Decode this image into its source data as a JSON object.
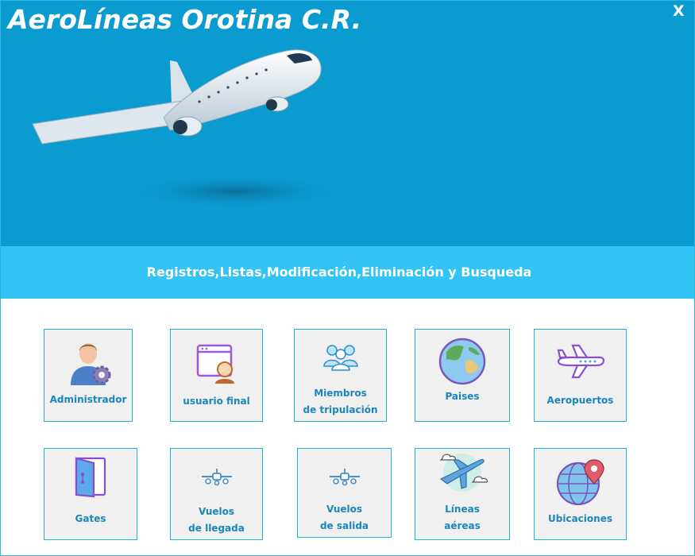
{
  "window": {
    "title": "AeroLíneas Orotina C.R.",
    "close_label": "X"
  },
  "subtitle": "Registros,Listas,Modificación,Eliminación y Busqueda",
  "colors": {
    "hero_background": "#0a9bd0",
    "band_background": "#33c4f5",
    "tile_border": "#24b1d6",
    "tile_background": "#f0f0f0",
    "tile_label": "#1b86bb"
  },
  "tiles": [
    {
      "label_line1": "Administrador",
      "label_line2": "",
      "icon": "admin-user-gear-icon"
    },
    {
      "label_line1": "usuario final",
      "label_line2": "",
      "icon": "end-user-browser-icon"
    },
    {
      "label_line1": "Miembros",
      "label_line2": "de tripulación",
      "icon": "crew-group-icon"
    },
    {
      "label_line1": "Paises",
      "label_line2": "",
      "icon": "globe-icon"
    },
    {
      "label_line1": "Aeropuertos",
      "label_line2": "",
      "icon": "airplane-icon"
    },
    {
      "label_line1": "Gates",
      "label_line2": "",
      "icon": "gate-door-icon"
    },
    {
      "label_line1": "Vuelos",
      "label_line2": "de llegada",
      "icon": "small-plane-icon"
    },
    {
      "label_line1": "Vuelos",
      "label_line2": "de salida",
      "icon": "small-plane-icon"
    },
    {
      "label_line1": "Líneas",
      "label_line2": "aéreas",
      "icon": "plane-clouds-icon"
    },
    {
      "label_line1": "Ubicaciones",
      "label_line2": "",
      "icon": "globe-location-pin-icon"
    }
  ]
}
